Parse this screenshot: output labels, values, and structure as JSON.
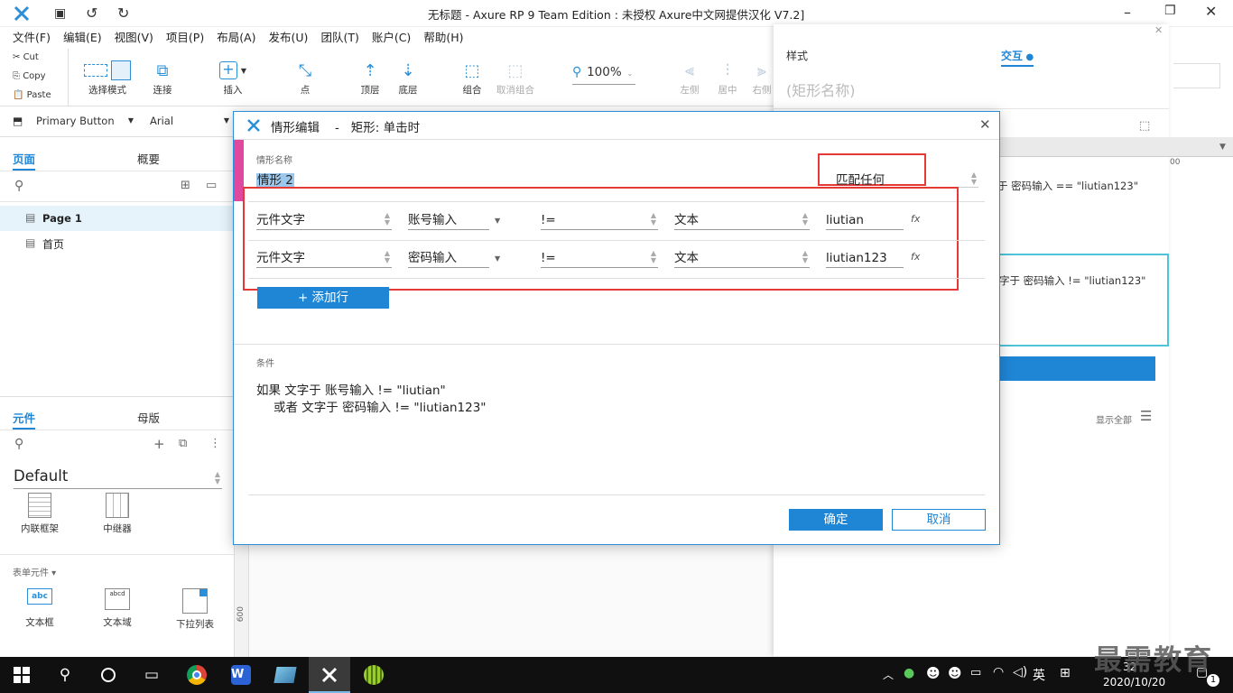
{
  "titlebar": {
    "title": "无标题 - Axure RP 9 Team Edition : 未授权",
    "subtitle": "Axure中文网提供汉化 V7.2]"
  },
  "menu": [
    "文件(F)",
    "编辑(E)",
    "视图(V)",
    "项目(P)",
    "布局(A)",
    "发布(U)",
    "团队(T)",
    "账户(C)",
    "帮助(H)"
  ],
  "clipboard": {
    "cut": "Cut",
    "copy": "Copy",
    "paste": "Paste"
  },
  "toolbar": {
    "select_mode": "选择模式",
    "connect": "连接",
    "insert": "插入",
    "point": "点",
    "top": "顶层",
    "bottom": "底层",
    "group": "组合",
    "ungroup": "取消组合",
    "zoom": "100%",
    "left": "左侧",
    "center": "居中",
    "right": "右侧"
  },
  "format": {
    "style": "Primary Button",
    "font": "Arial"
  },
  "left_panel": {
    "tab_pages": "页面",
    "tab_outline": "概要",
    "pages": [
      "Page 1",
      "首页"
    ],
    "tab_widgets": "元件",
    "tab_masters": "母版",
    "library": "Default",
    "widgets_row1": [
      "内联框架",
      "中继器"
    ],
    "forms_header": "表单元件 ▾",
    "widgets_row2": [
      "文本框",
      "文本域",
      "下拉列表"
    ]
  },
  "right_panel": {
    "tab_style": "样式",
    "tab_interact": "交互",
    "shape_name_placeholder": "(矩形名称)",
    "cond_text_1": "于 密码输入 == \"liutian123\"",
    "cond_text_2": "字于 密码输入 != \"liutian123\"",
    "show_all": "显示全部",
    "ruler_mark": "00"
  },
  "canvas": {
    "ruler_600": "600"
  },
  "dialog": {
    "title": "情形编辑",
    "subtitle": "-   矩形: 单击时",
    "name_label": "情形名称",
    "name_value": "情形 2",
    "match_label": "匹配任何",
    "rows": [
      {
        "target": "元件文字",
        "widget": "账号输入",
        "op": "!=",
        "type": "文本",
        "value": "liutian"
      },
      {
        "target": "元件文字",
        "widget": "密码输入",
        "op": "!=",
        "type": "文本",
        "value": "liutian123"
      }
    ],
    "fx_label": "fx",
    "add_row": "+ 添加行",
    "cond_label": "条件",
    "cond_line1": "如果 文字于 账号输入 != \"liutian\"",
    "cond_line2": "或者 文字于 密码输入 != \"liutian123\"",
    "ok": "确定",
    "cancel": "取消"
  },
  "taskbar": {
    "ime": "英",
    "time": "32",
    "date": "2020/10/20",
    "notif": "1"
  },
  "watermark": "最需教育",
  "colors": {
    "accent": "#1f86d6",
    "highlight": "#e53935",
    "pink": "#e0479e"
  }
}
